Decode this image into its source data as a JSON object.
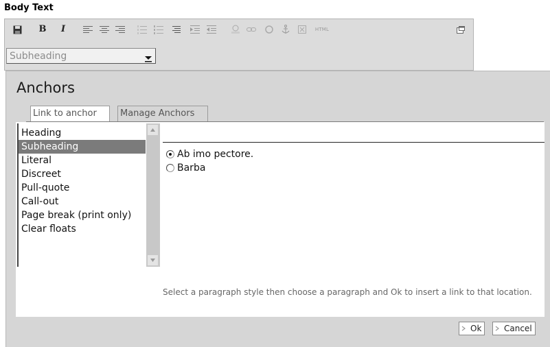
{
  "field": {
    "label": "Body Text"
  },
  "toolbar": {
    "bold_label": "B",
    "italic_label": "I",
    "html_label": "HTML",
    "icons": [
      "save-icon",
      "bold-icon",
      "italic-icon",
      "align-left-icon",
      "align-center-icon",
      "align-right-icon",
      "ordered-list-icon",
      "unordered-list-icon",
      "definition-list-icon",
      "indent-icon",
      "outdent-icon",
      "image-icon",
      "link-icon",
      "globe-icon",
      "anchor-icon",
      "table-icon",
      "html-icon",
      "maximize-icon"
    ]
  },
  "style_select": {
    "value": "Subheading"
  },
  "dialog": {
    "title": "Anchors",
    "tabs": [
      {
        "label": "Link to anchor"
      },
      {
        "label": "Manage Anchors"
      }
    ],
    "styles": [
      {
        "label": "Heading"
      },
      {
        "label": "Subheading"
      },
      {
        "label": "Literal"
      },
      {
        "label": "Discreet"
      },
      {
        "label": "Pull-quote"
      },
      {
        "label": "Call-out"
      },
      {
        "label": "Page break (print only)"
      },
      {
        "label": "Clear floats"
      }
    ],
    "selected_style": "Subheading",
    "paragraphs": [
      {
        "label": "Ab imo pectore.",
        "checked": true
      },
      {
        "label": "Barba",
        "checked": false
      }
    ],
    "hint": "Select a paragraph style then choose a paragraph and Ok to insert a link to that location.",
    "ok_label": "Ok",
    "cancel_label": "Cancel"
  },
  "colors": {
    "selection_bg": "#7b7b7b",
    "dialog_bg": "#d6d6d6",
    "toolbar_bg": "#dcdcdc"
  }
}
